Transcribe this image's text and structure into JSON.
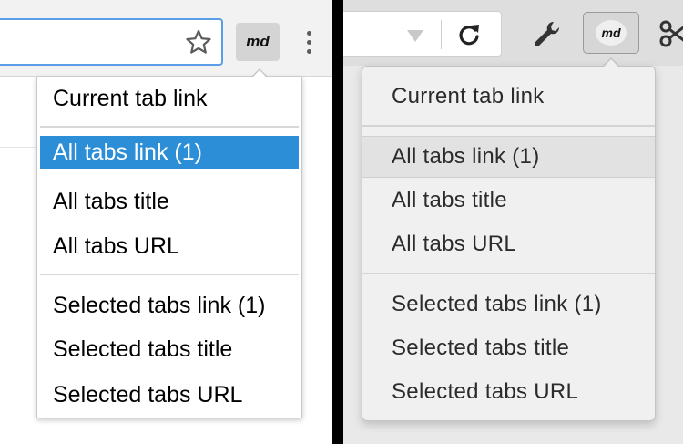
{
  "left": {
    "md_button_label": "md",
    "menu": {
      "section1": [
        "Current tab link"
      ],
      "section2": [
        "All tabs link (1)",
        "All tabs title",
        "All tabs URL"
      ],
      "section3": [
        "Selected tabs link (1)",
        "Selected tabs title",
        "Selected tabs URL"
      ],
      "highlighted_item": "All tabs link (1)"
    },
    "colors": {
      "highlight": "#2d8ed8",
      "omnibox_border": "#5a9ee8"
    }
  },
  "right": {
    "md_button_label": "md",
    "menu": {
      "section1": [
        "Current tab link"
      ],
      "section2": [
        "All tabs link (1)",
        "All tabs title",
        "All tabs URL"
      ],
      "section3": [
        "Selected tabs link (1)",
        "Selected tabs title",
        "Selected tabs URL"
      ],
      "highlighted_item": "All tabs link (1)"
    },
    "colors": {
      "highlight": "#e2e2e2"
    }
  }
}
